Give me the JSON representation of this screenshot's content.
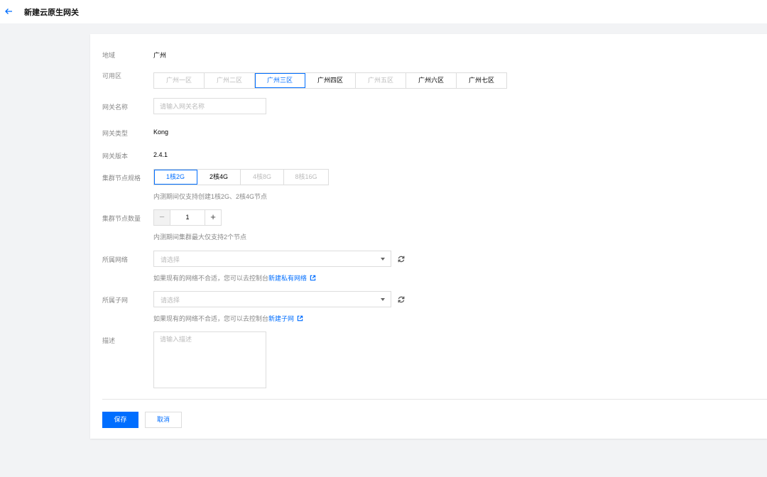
{
  "header": {
    "title": "新建云原生网关"
  },
  "form": {
    "region": {
      "label": "地域",
      "value": "广州"
    },
    "zone": {
      "label": "可用区",
      "options": [
        {
          "label": "广州一区",
          "state": "disabled"
        },
        {
          "label": "广州二区",
          "state": "disabled"
        },
        {
          "label": "广州三区",
          "state": "selected"
        },
        {
          "label": "广州四区",
          "state": "normal"
        },
        {
          "label": "广州五区",
          "state": "disabled"
        },
        {
          "label": "广州六区",
          "state": "normal"
        },
        {
          "label": "广州七区",
          "state": "normal"
        }
      ]
    },
    "gateway_name": {
      "label": "网关名称",
      "placeholder": "请输入网关名称",
      "value": ""
    },
    "gateway_type": {
      "label": "网关类型",
      "value": "Kong"
    },
    "gateway_version": {
      "label": "网关版本",
      "value": "2.4.1"
    },
    "node_spec": {
      "label": "集群节点规格",
      "options": [
        {
          "label": "1核2G",
          "state": "selected"
        },
        {
          "label": "2核4G",
          "state": "normal"
        },
        {
          "label": "4核8G",
          "state": "disabled"
        },
        {
          "label": "8核16G",
          "state": "disabled"
        }
      ],
      "hint": "内测期间仅支持创建1核2G、2核4G节点"
    },
    "node_count": {
      "label": "集群节点数量",
      "minus": "−",
      "plus": "+",
      "value": "1",
      "hint": "内测期间集群最大仅支持2个节点"
    },
    "network": {
      "label": "所属网络",
      "placeholder": "请选择",
      "hint_prefix": "如果现有的网络不合适，您可以去控制台",
      "hint_link": "新建私有网络"
    },
    "subnet": {
      "label": "所属子网",
      "placeholder": "请选择",
      "hint_prefix": "如果现有的网络不合适，您可以去控制台",
      "hint_link": "新建子网"
    },
    "description": {
      "label": "描述",
      "placeholder": "请输入描述",
      "value": ""
    }
  },
  "actions": {
    "save": "保存",
    "cancel": "取消"
  },
  "colors": {
    "accent": "#006eff",
    "label": "#888888",
    "border": "#dddddd",
    "background": "#f2f3f5"
  }
}
